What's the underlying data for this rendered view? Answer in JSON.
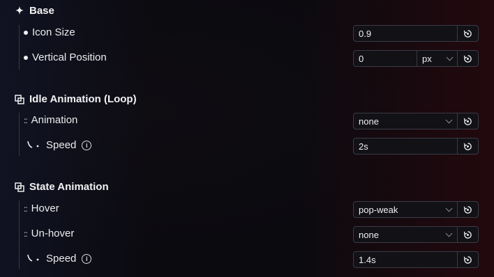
{
  "sections": [
    {
      "title": "Base",
      "icon": "sparkle-icon",
      "rows": [
        {
          "label": "Icon Size",
          "value": "0.9"
        },
        {
          "label": "Vertical Position",
          "value": "0",
          "unit": "px"
        }
      ]
    },
    {
      "title": "Idle Animation (Loop)",
      "icon": "layers-icon",
      "rows": [
        {
          "label": "Animation",
          "value": "none"
        },
        {
          "label": "Speed",
          "value": "2s"
        }
      ]
    },
    {
      "title": "State Animation",
      "icon": "layers-icon",
      "rows": [
        {
          "label": "Hover",
          "value": "pop-weak"
        },
        {
          "label": "Un-hover",
          "value": "none"
        },
        {
          "label": "Speed",
          "value": "1.4s"
        }
      ]
    }
  ]
}
